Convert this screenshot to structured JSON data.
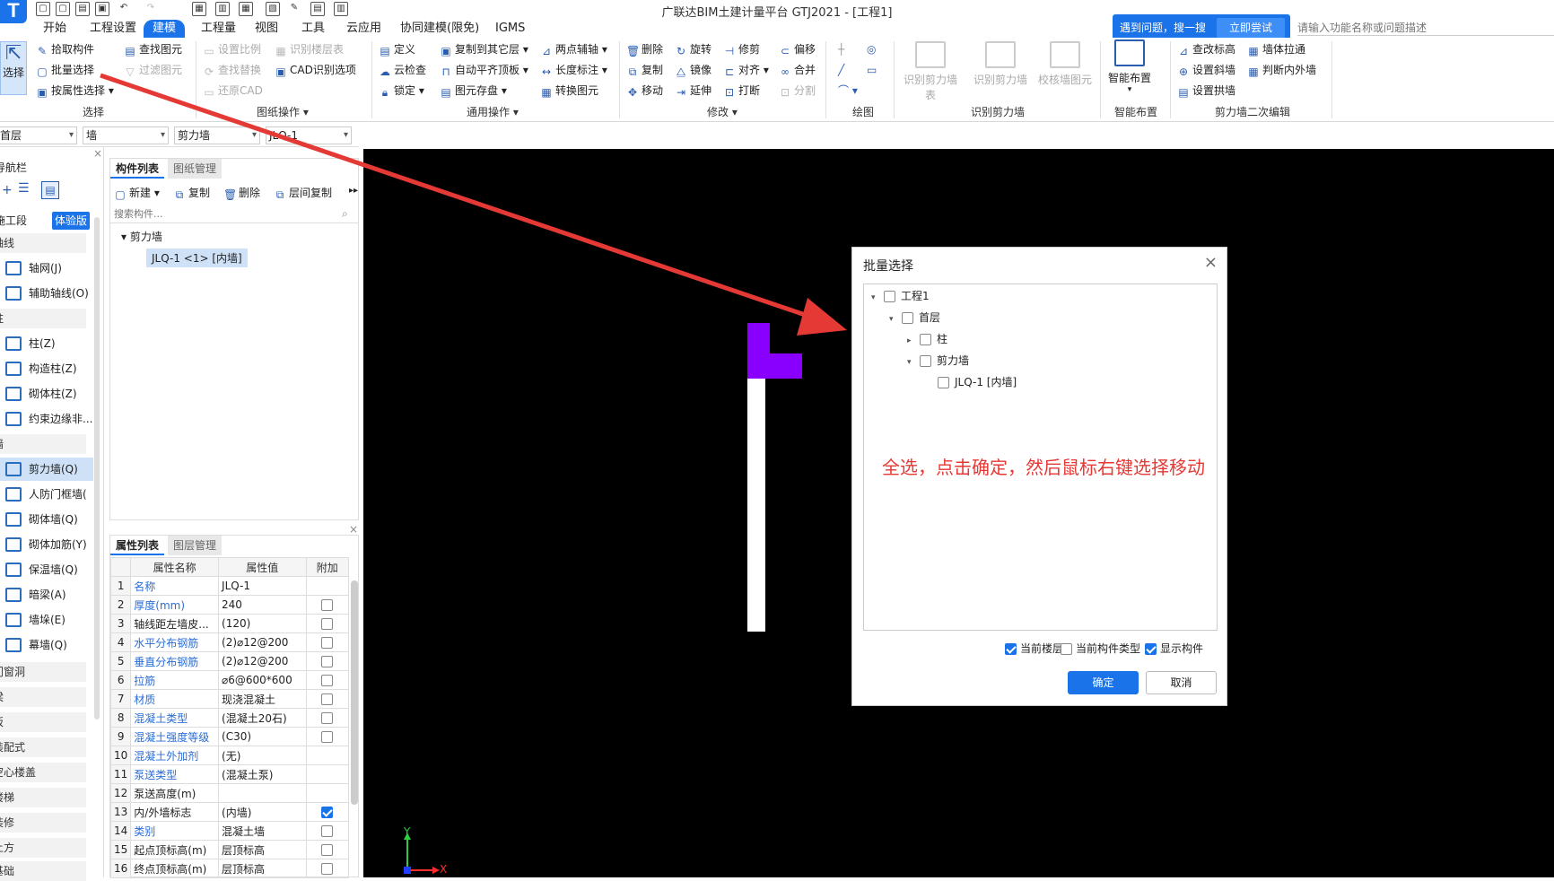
{
  "app": {
    "title": "广联达BIM土建计量平台 GTJ2021 - [工程1]",
    "logo": "T"
  },
  "menu": [
    {
      "label": "开始"
    },
    {
      "label": "工程设置"
    },
    {
      "label": "建模",
      "active": true
    },
    {
      "label": "工程量"
    },
    {
      "label": "视图"
    },
    {
      "label": "工具"
    },
    {
      "label": "云应用"
    },
    {
      "label": "协同建模(限免)"
    },
    {
      "label": "IGMS"
    }
  ],
  "help": {
    "text": "遇到问题，搜一搜",
    "button": "立即尝试",
    "search_placeholder": "请输入功能名称或问题描述"
  },
  "ribbon": {
    "select_big": "选择",
    "select_items": [
      "拾取构件",
      "批量选择",
      "按属性选择",
      "查找图元",
      "过滤图元"
    ],
    "select_group": "选择",
    "drawing_items": [
      "设置比例",
      "识别楼层表",
      "查找替换",
      "CAD识别选项",
      "还原CAD"
    ],
    "drawing_group": "图纸操作",
    "general_items": [
      "定义",
      "复制到其它层",
      "两点辅轴",
      "云检查",
      "自动平齐顶板",
      "长度标注",
      "锁定",
      "图元存盘",
      "转换图元"
    ],
    "general_group": "通用操作",
    "modify_items": [
      "删除",
      "旋转",
      "修剪",
      "偏移",
      "复制",
      "镜像",
      "对齐",
      "合并",
      "移动",
      "延伸",
      "打断",
      "分割"
    ],
    "modify_group": "修改",
    "draw_group": "绘图",
    "recog_items": [
      "识别剪力墙表",
      "识别剪力墙",
      "校核墙图元"
    ],
    "recog_group": "识别剪力墙",
    "smart_big": "智能布置",
    "smart_group": "智能布置",
    "edit_items": [
      "查改标高",
      "墙体拉通",
      "设置斜墙",
      "判断内外墙",
      "设置拱墙"
    ],
    "edit_group": "剪力墙二次编辑"
  },
  "selectors": [
    "首层",
    "墙",
    "剪力墙",
    "JLQ-1"
  ],
  "nav": {
    "title": "导航栏",
    "segment": "施工段",
    "segment_badge": "体验版",
    "sections": [
      {
        "label": "轴线"
      },
      {
        "label": "柱"
      },
      {
        "label": "墙"
      },
      {
        "label": "门窗洞"
      },
      {
        "label": "梁"
      },
      {
        "label": "板"
      },
      {
        "label": "装配式"
      },
      {
        "label": "空心楼盖"
      },
      {
        "label": "楼梯"
      },
      {
        "label": "装修"
      },
      {
        "label": "土方"
      },
      {
        "label": "基础"
      }
    ],
    "items": [
      {
        "label": "轴网(J)"
      },
      {
        "label": "辅助轴线(O)"
      },
      {
        "label": "柱(Z)"
      },
      {
        "label": "构造柱(Z)"
      },
      {
        "label": "砌体柱(Z)"
      },
      {
        "label": "约束边缘非..."
      },
      {
        "label": "剪力墙(Q)"
      },
      {
        "label": "人防门框墙("
      },
      {
        "label": "砌体墙(Q)"
      },
      {
        "label": "砌体加筋(Y)"
      },
      {
        "label": "保温墙(Q)"
      },
      {
        "label": "暗梁(A)"
      },
      {
        "label": "墙垛(E)"
      },
      {
        "label": "幕墙(Q)"
      }
    ]
  },
  "component_panel": {
    "tabs": [
      "构件列表",
      "图纸管理"
    ],
    "toolbar": [
      "新建",
      "复制",
      "删除",
      "层间复制"
    ],
    "search_placeholder": "搜索构件...",
    "tree_root": "剪力墙",
    "tree_item": "JLQ-1 <1> [内墙]"
  },
  "property_panel": {
    "tabs": [
      "属性列表",
      "图层管理"
    ],
    "headers": [
      "属性名称",
      "属性值",
      "附加"
    ],
    "rows": [
      {
        "n": "1",
        "name": "名称",
        "value": "JLQ-1",
        "blue": true,
        "cb": "none"
      },
      {
        "n": "2",
        "name": "厚度(mm)",
        "value": "240",
        "blue": true,
        "cb": "off"
      },
      {
        "n": "3",
        "name": "轴线距左墙皮...",
        "value": "(120)",
        "blue": false,
        "cb": "off"
      },
      {
        "n": "4",
        "name": "水平分布钢筋",
        "value": "(2)⌀12@200",
        "blue": true,
        "cb": "off"
      },
      {
        "n": "5",
        "name": "垂直分布钢筋",
        "value": "(2)⌀12@200",
        "blue": true,
        "cb": "off"
      },
      {
        "n": "6",
        "name": "拉筋",
        "value": "⌀6@600*600",
        "blue": true,
        "cb": "off"
      },
      {
        "n": "7",
        "name": "材质",
        "value": "现浇混凝土",
        "blue": true,
        "cb": "off"
      },
      {
        "n": "8",
        "name": "混凝土类型",
        "value": "(混凝土20石)",
        "blue": true,
        "cb": "off"
      },
      {
        "n": "9",
        "name": "混凝土强度等级",
        "value": "(C30)",
        "blue": true,
        "cb": "off"
      },
      {
        "n": "10",
        "name": "混凝土外加剂",
        "value": "(无)",
        "blue": true,
        "cb": "none"
      },
      {
        "n": "11",
        "name": "泵送类型",
        "value": "(混凝土泵)",
        "blue": true,
        "cb": "none"
      },
      {
        "n": "12",
        "name": "泵送高度(m)",
        "value": "",
        "blue": false,
        "cb": "none"
      },
      {
        "n": "13",
        "name": "内/外墙标志",
        "value": "(内墙)",
        "blue": false,
        "cb": "on"
      },
      {
        "n": "14",
        "name": "类别",
        "value": "混凝土墙",
        "blue": true,
        "cb": "off"
      },
      {
        "n": "15",
        "name": "起点顶标高(m)",
        "value": "层顶标高",
        "blue": false,
        "cb": "off"
      },
      {
        "n": "16",
        "name": "终点顶标高(m)",
        "value": "层顶标高",
        "blue": false,
        "cb": "off"
      }
    ]
  },
  "canvas": {
    "axis_y": "Y",
    "axis_x": "X"
  },
  "dialog": {
    "title": "批量选择",
    "tree": [
      {
        "label": "工程1",
        "level": 0,
        "arrow": "▾"
      },
      {
        "label": "首层",
        "level": 1,
        "arrow": "▾"
      },
      {
        "label": "柱",
        "level": 2,
        "arrow": "▸"
      },
      {
        "label": "剪力墙",
        "level": 2,
        "arrow": "▾"
      },
      {
        "label": "JLQ-1 [内墙]",
        "level": 3,
        "arrow": ""
      }
    ],
    "note": "全选，点击确定，然后鼠标右键选择移动",
    "options": [
      {
        "label": "当前楼层",
        "checked": true
      },
      {
        "label": "当前构件类型",
        "checked": false
      },
      {
        "label": "显示构件",
        "checked": true
      }
    ],
    "ok": "确定",
    "cancel": "取消"
  },
  "colors": {
    "accent": "#1a73e8",
    "arrow": "#e53935",
    "wall_highlight": "#8a00ff",
    "canvas_bg": "#000000"
  }
}
